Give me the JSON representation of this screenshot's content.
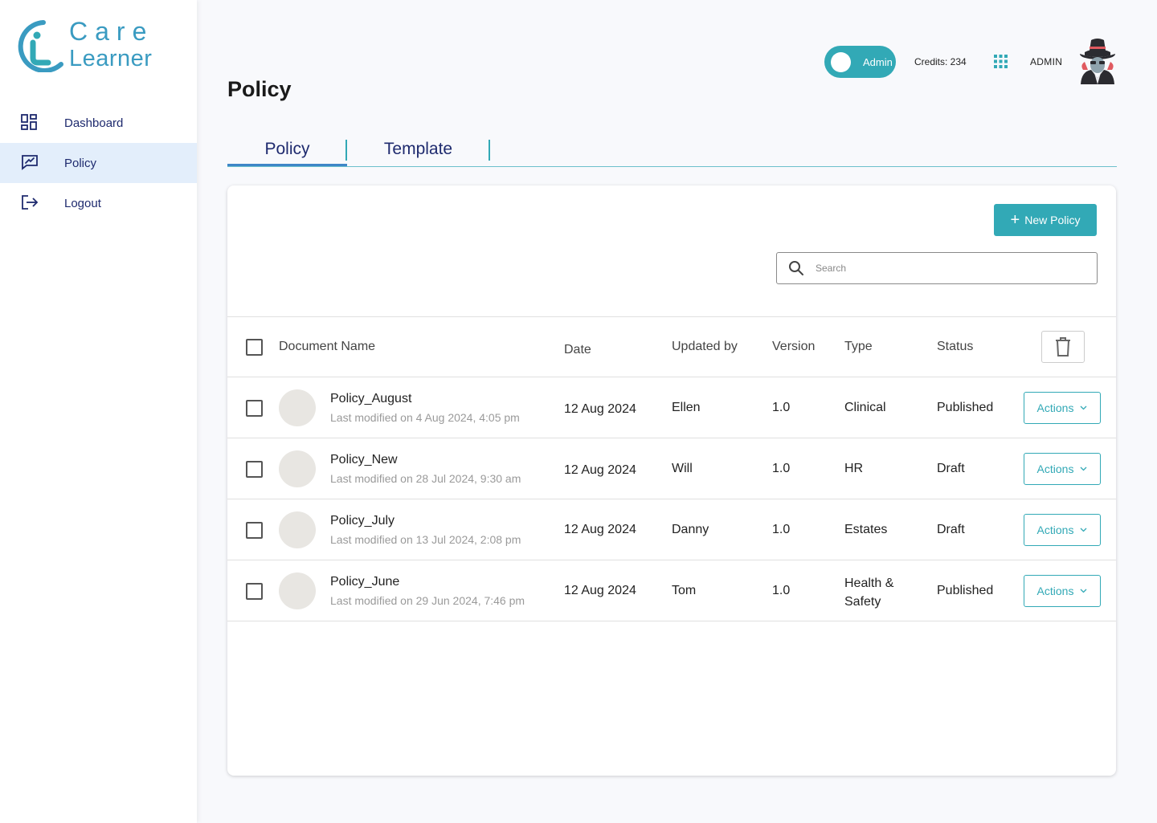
{
  "brand": {
    "line1": "Care",
    "line2": "Learner",
    "color": "#3a9bc1"
  },
  "sidebar": {
    "items": [
      {
        "label": "Dashboard",
        "icon": "dashboard-icon",
        "active": false
      },
      {
        "label": "Policy",
        "icon": "policy-icon",
        "active": true
      },
      {
        "label": "Logout",
        "icon": "logout-icon",
        "active": false
      }
    ]
  },
  "header": {
    "title": "Policy",
    "role_toggle": "Admin",
    "credits": "Credits: 234",
    "user_name": "ADMIN",
    "apps_icon": "grid-apps-icon",
    "avatar_icon": "spy-avatar-icon"
  },
  "tabs": [
    {
      "label": "Policy",
      "active": true
    },
    {
      "label": "Template",
      "active": false
    }
  ],
  "toolbar": {
    "new_button": "New Policy",
    "search_placeholder": "Search"
  },
  "table": {
    "columns": [
      "Document Name",
      "Date",
      "Updated by",
      "Version",
      "Type",
      "Status"
    ],
    "action_label": "Actions",
    "rows": [
      {
        "name": "Policy_August",
        "modified": "Last modified on 4 Aug 2024, 4:05 pm",
        "date": "12 Aug 2024",
        "updated_by": "Ellen",
        "version": "1.0",
        "type": "Clinical",
        "status": "Published"
      },
      {
        "name": "Policy_New",
        "modified": "Last modified on 28 Jul 2024, 9:30 am",
        "date": "12 Aug 2024",
        "updated_by": "Will",
        "version": "1.0",
        "type": "HR",
        "status": "Draft"
      },
      {
        "name": "Policy_July",
        "modified": "Last modified on 13 Jul 2024, 2:08 pm",
        "date": "12 Aug 2024",
        "updated_by": "Danny",
        "version": "1.0",
        "type": "Estates",
        "status": "Draft"
      },
      {
        "name": "Policy_June",
        "modified": "Last modified on 29 Jun 2024, 7:46 pm",
        "date": "12 Aug 2024",
        "updated_by": "Tom",
        "version": "1.0",
        "type": "Health & Safety",
        "status": "Published"
      }
    ]
  },
  "colors": {
    "accent": "#32a9b6",
    "nav_text": "#1e2a6e",
    "active_bg": "#e3eefb"
  }
}
